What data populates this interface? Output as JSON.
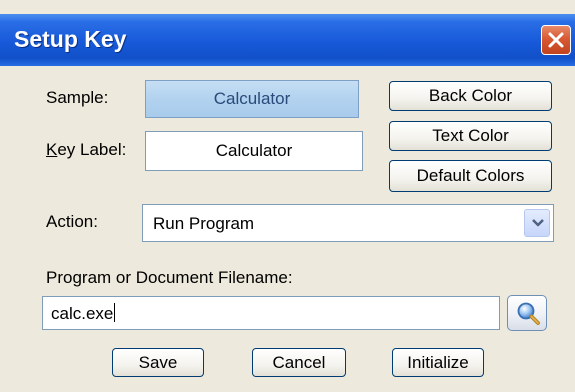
{
  "window": {
    "title": "Setup Key",
    "close_icon": "close-x-icon",
    "title_color": "#1759d9",
    "close_color": "#d85a34"
  },
  "labels": {
    "sample": "Sample:",
    "key_label_mnemonic": "K",
    "key_label_rest": "ey Label:",
    "action": "Action:",
    "filename": "Program or Document Filename:"
  },
  "sample": {
    "text": "Calculator",
    "background": "#b2d2ef",
    "text_color": "#2a4a7a"
  },
  "key_label": {
    "value": "Calculator"
  },
  "color_buttons": {
    "back_color": "Back Color",
    "text_color": "Text Color",
    "default_colors": "Default Colors"
  },
  "action": {
    "selected": "Run Program",
    "dropdown_icon": "chevron-down-icon"
  },
  "filename": {
    "value": "calc.exe",
    "browse_icon": "magnifier-icon"
  },
  "footer": {
    "save": "Save",
    "cancel": "Cancel",
    "initialize": "Initialize"
  }
}
